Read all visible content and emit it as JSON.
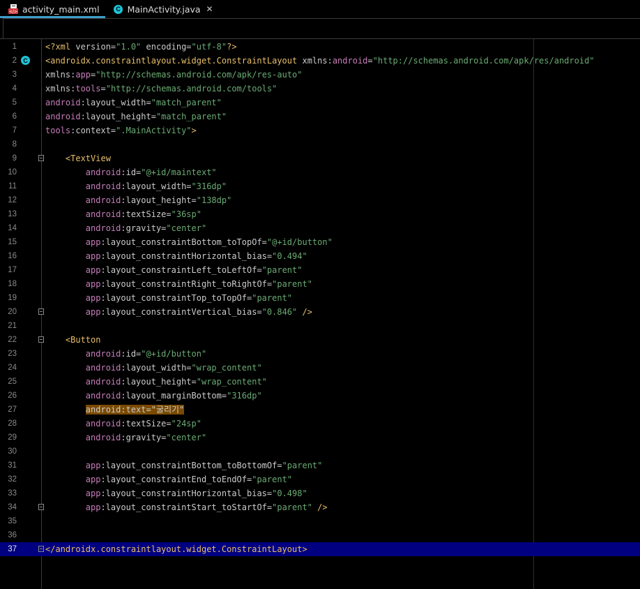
{
  "tabs": [
    {
      "label": "activity_main.xml",
      "icon": "xml-layout-icon",
      "active": true
    },
    {
      "label": "MainActivity.java",
      "icon": "java-class-icon",
      "active": false
    }
  ],
  "editor": {
    "current_line": 37,
    "lines": [
      {
        "n": "1",
        "tokens": [
          [
            "tag",
            "<?xml "
          ],
          [
            "plain",
            "version="
          ],
          [
            "val",
            "\"1.0\""
          ],
          [
            "plain",
            " encoding="
          ],
          [
            "val",
            "\"utf-8\""
          ],
          [
            "tag",
            "?>"
          ]
        ]
      },
      {
        "n": "2",
        "icon": true,
        "tokens": [
          [
            "tag",
            "<androidx.constraintlayout.widget.ConstraintLayout "
          ],
          [
            "plain",
            "xmlns:"
          ],
          [
            "ns",
            "android"
          ],
          [
            "plain",
            "="
          ],
          [
            "val",
            "\"http://schemas.android.com/apk/res/android\""
          ]
        ]
      },
      {
        "n": "3",
        "tokens": [
          [
            "plain",
            "xmlns:"
          ],
          [
            "ns",
            "app"
          ],
          [
            "plain",
            "="
          ],
          [
            "val",
            "\"http://schemas.android.com/apk/res-auto\""
          ]
        ]
      },
      {
        "n": "4",
        "tokens": [
          [
            "plain",
            "xmlns:"
          ],
          [
            "ns",
            "tools"
          ],
          [
            "plain",
            "="
          ],
          [
            "val",
            "\"http://schemas.android.com/tools\""
          ]
        ]
      },
      {
        "n": "5",
        "tokens": [
          [
            "ns",
            "android"
          ],
          [
            "plain",
            ":layout_width="
          ],
          [
            "val",
            "\"match_parent\""
          ]
        ]
      },
      {
        "n": "6",
        "tokens": [
          [
            "ns",
            "android"
          ],
          [
            "plain",
            ":layout_height="
          ],
          [
            "val",
            "\"match_parent\""
          ]
        ]
      },
      {
        "n": "7",
        "tokens": [
          [
            "ns",
            "tools"
          ],
          [
            "plain",
            ":context="
          ],
          [
            "val",
            "\".MainActivity\""
          ],
          [
            "tag",
            ">"
          ]
        ]
      },
      {
        "n": "8",
        "tokens": []
      },
      {
        "n": "9",
        "fold": true,
        "tokens": [
          [
            "plain",
            "    "
          ],
          [
            "tag",
            "<TextView"
          ]
        ]
      },
      {
        "n": "10",
        "tokens": [
          [
            "plain",
            "        "
          ],
          [
            "ns",
            "android"
          ],
          [
            "plain",
            ":id="
          ],
          [
            "val",
            "\"@+id/maintext\""
          ]
        ]
      },
      {
        "n": "11",
        "tokens": [
          [
            "plain",
            "        "
          ],
          [
            "ns",
            "android"
          ],
          [
            "plain",
            ":layout_width="
          ],
          [
            "val",
            "\"316dp\""
          ]
        ]
      },
      {
        "n": "12",
        "tokens": [
          [
            "plain",
            "        "
          ],
          [
            "ns",
            "android"
          ],
          [
            "plain",
            ":layout_height="
          ],
          [
            "val",
            "\"138dp\""
          ]
        ]
      },
      {
        "n": "13",
        "tokens": [
          [
            "plain",
            "        "
          ],
          [
            "ns",
            "android"
          ],
          [
            "plain",
            ":textSize="
          ],
          [
            "val",
            "\"36sp\""
          ]
        ]
      },
      {
        "n": "14",
        "tokens": [
          [
            "plain",
            "        "
          ],
          [
            "ns",
            "android"
          ],
          [
            "plain",
            ":gravity="
          ],
          [
            "val",
            "\"center\""
          ]
        ]
      },
      {
        "n": "15",
        "tokens": [
          [
            "plain",
            "        "
          ],
          [
            "ns",
            "app"
          ],
          [
            "plain",
            ":layout_constraintBottom_toTopOf="
          ],
          [
            "val",
            "\"@+id/button\""
          ]
        ]
      },
      {
        "n": "16",
        "tokens": [
          [
            "plain",
            "        "
          ],
          [
            "ns",
            "app"
          ],
          [
            "plain",
            ":layout_constraintHorizontal_bias="
          ],
          [
            "val",
            "\"0.494\""
          ]
        ]
      },
      {
        "n": "17",
        "tokens": [
          [
            "plain",
            "        "
          ],
          [
            "ns",
            "app"
          ],
          [
            "plain",
            ":layout_constraintLeft_toLeftOf="
          ],
          [
            "val",
            "\"parent\""
          ]
        ]
      },
      {
        "n": "18",
        "tokens": [
          [
            "plain",
            "        "
          ],
          [
            "ns",
            "app"
          ],
          [
            "plain",
            ":layout_constraintRight_toRightOf="
          ],
          [
            "val",
            "\"parent\""
          ]
        ]
      },
      {
        "n": "19",
        "tokens": [
          [
            "plain",
            "        "
          ],
          [
            "ns",
            "app"
          ],
          [
            "plain",
            ":layout_constraintTop_toTopOf="
          ],
          [
            "val",
            "\"parent\""
          ]
        ]
      },
      {
        "n": "20",
        "fold": true,
        "tokens": [
          [
            "plain",
            "        "
          ],
          [
            "ns",
            "app"
          ],
          [
            "plain",
            ":layout_constraintVertical_bias="
          ],
          [
            "val",
            "\"0.846\""
          ],
          [
            "tag",
            " />"
          ]
        ]
      },
      {
        "n": "21",
        "tokens": []
      },
      {
        "n": "22",
        "fold": true,
        "tokens": [
          [
            "plain",
            "    "
          ],
          [
            "tag",
            "<Button"
          ]
        ]
      },
      {
        "n": "23",
        "tokens": [
          [
            "plain",
            "        "
          ],
          [
            "ns",
            "android"
          ],
          [
            "plain",
            ":id="
          ],
          [
            "val",
            "\"@+id/button\""
          ]
        ]
      },
      {
        "n": "24",
        "tokens": [
          [
            "plain",
            "        "
          ],
          [
            "ns",
            "android"
          ],
          [
            "plain",
            ":layout_width="
          ],
          [
            "val",
            "\"wrap_content\""
          ]
        ]
      },
      {
        "n": "25",
        "tokens": [
          [
            "plain",
            "        "
          ],
          [
            "ns",
            "android"
          ],
          [
            "plain",
            ":layout_height="
          ],
          [
            "val",
            "\"wrap_content\""
          ]
        ]
      },
      {
        "n": "26",
        "tokens": [
          [
            "plain",
            "        "
          ],
          [
            "ns",
            "android"
          ],
          [
            "plain",
            ":layout_marginBottom="
          ],
          [
            "val",
            "\"316dp\""
          ]
        ]
      },
      {
        "n": "27",
        "tokens": [
          [
            "plain",
            "        "
          ],
          [
            "hl",
            "android:text=\"굴리기\""
          ]
        ]
      },
      {
        "n": "28",
        "tokens": [
          [
            "plain",
            "        "
          ],
          [
            "ns",
            "android"
          ],
          [
            "plain",
            ":textSize="
          ],
          [
            "val",
            "\"24sp\""
          ]
        ]
      },
      {
        "n": "29",
        "tokens": [
          [
            "plain",
            "        "
          ],
          [
            "ns",
            "android"
          ],
          [
            "plain",
            ":gravity="
          ],
          [
            "val",
            "\"center\""
          ]
        ]
      },
      {
        "n": "30",
        "tokens": []
      },
      {
        "n": "31",
        "tokens": [
          [
            "plain",
            "        "
          ],
          [
            "ns",
            "app"
          ],
          [
            "plain",
            ":layout_constraintBottom_toBottomOf="
          ],
          [
            "val",
            "\"parent\""
          ]
        ]
      },
      {
        "n": "32",
        "tokens": [
          [
            "plain",
            "        "
          ],
          [
            "ns",
            "app"
          ],
          [
            "plain",
            ":layout_constraintEnd_toEndOf="
          ],
          [
            "val",
            "\"parent\""
          ]
        ]
      },
      {
        "n": "33",
        "tokens": [
          [
            "plain",
            "        "
          ],
          [
            "ns",
            "app"
          ],
          [
            "plain",
            ":layout_constraintHorizontal_bias="
          ],
          [
            "val",
            "\"0.498\""
          ]
        ]
      },
      {
        "n": "34",
        "fold": true,
        "tokens": [
          [
            "plain",
            "        "
          ],
          [
            "ns",
            "app"
          ],
          [
            "plain",
            ":layout_constraintStart_toStartOf="
          ],
          [
            "val",
            "\"parent\""
          ],
          [
            "tag",
            " />"
          ]
        ]
      },
      {
        "n": "35",
        "tokens": []
      },
      {
        "n": "36",
        "tokens": []
      },
      {
        "n": "37",
        "fold": true,
        "tokens": [
          [
            "tag",
            "</androidx.constraintlayout.widget.ConstraintLayout>"
          ]
        ]
      }
    ]
  },
  "colors": {
    "accent": "#3d9ec9",
    "current_line_bg": "#000080",
    "tag": "#e8bf6a",
    "namespace": "#c77dbb",
    "value": "#6aab73"
  }
}
